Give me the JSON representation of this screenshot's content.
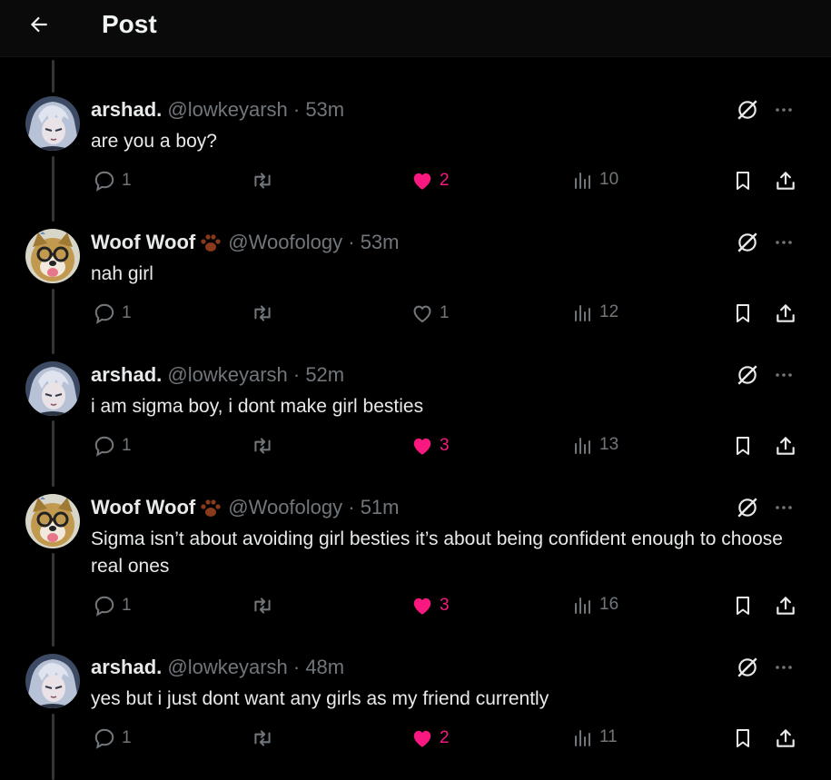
{
  "header": {
    "title": "Post"
  },
  "tweets": [
    {
      "name": "arshad.",
      "handle": "@lowkeyarsh · 53m",
      "text": "are you a boy?",
      "replies": "1",
      "likes": "2",
      "liked": true,
      "views": "10",
      "avatar": "anime"
    },
    {
      "name": "Woof Woof",
      "handle": "@Woofology · 53m",
      "text": "nah girl",
      "replies": "1",
      "likes": "1",
      "liked": false,
      "views": "12",
      "avatar": "dog"
    },
    {
      "name": "arshad.",
      "handle": "@lowkeyarsh · 52m",
      "text": "i am sigma boy, i dont make girl besties",
      "replies": "1",
      "likes": "3",
      "liked": true,
      "views": "13",
      "avatar": "anime"
    },
    {
      "name": "Woof Woof",
      "handle": "@Woofology · 51m",
      "text": "Sigma isn’t about avoiding girl besties it’s about being confident enough to choose real ones",
      "replies": "1",
      "likes": "3",
      "liked": true,
      "views": "16",
      "avatar": "dog"
    },
    {
      "name": "arshad.",
      "handle": "@lowkeyarsh · 48m",
      "text": "yes but i just dont want any girls as my friend currently",
      "replies": "1",
      "likes": "2",
      "liked": true,
      "views": "11",
      "avatar": "anime"
    }
  ],
  "colors": {
    "like": "#f91880",
    "muted": "#71767b",
    "text": "#e7e9ea",
    "background": "#000000"
  },
  "icons": [
    "back-arrow-icon",
    "grok-icon",
    "more-icon",
    "reply-icon",
    "retweet-icon",
    "like-icon",
    "views-icon",
    "bookmark-icon",
    "share-icon",
    "paw-icon"
  ]
}
